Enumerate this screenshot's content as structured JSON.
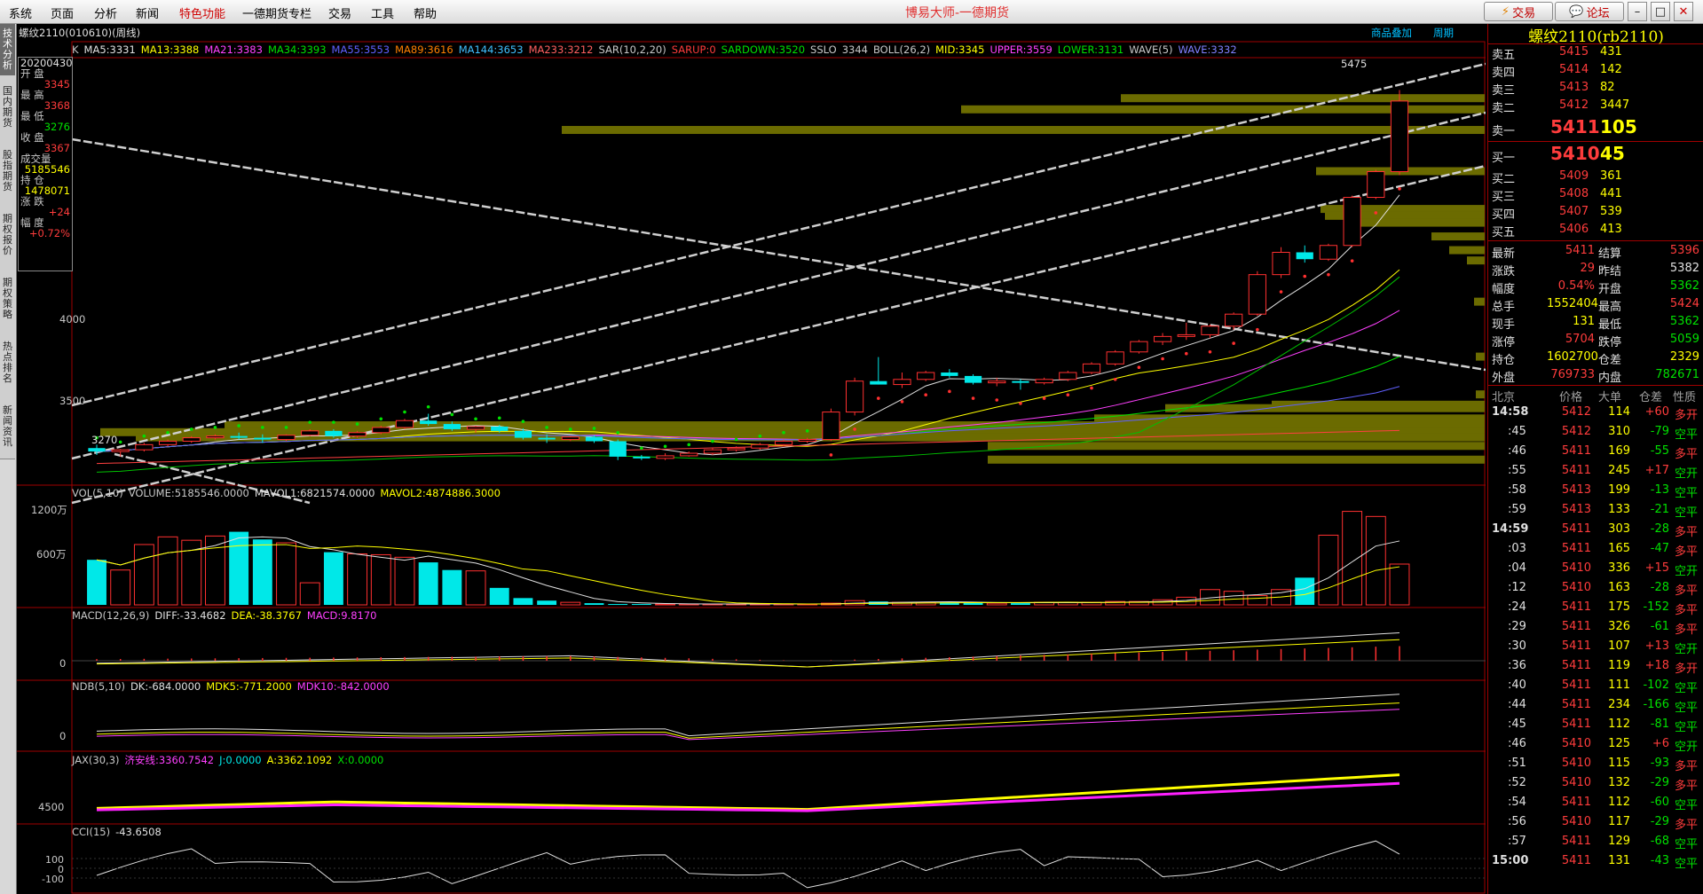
{
  "menu": {
    "items": [
      "系统",
      "页面",
      "分析",
      "新闻",
      "特色功能",
      "一德期货专栏",
      "交易",
      "工具",
      "帮助"
    ],
    "app_title": "博易大师-一德期货",
    "trade_button": "交易",
    "forum_button": "论坛"
  },
  "sidebar": {
    "tabs": [
      "技术分析",
      "国内期货",
      "股指期货",
      "期权报价",
      "期权策略",
      "热点排名",
      "新闻资讯"
    ]
  },
  "chart": {
    "title": "螺纹2110(010610)(周线)",
    "top_links": [
      "商品叠加",
      "周期"
    ],
    "peak_label": "5475",
    "low_label": "3270",
    "indicator_line": [
      {
        "text": "K",
        "color": "#c8c8c8"
      },
      {
        "text": "MA5:3331",
        "color": "#e0e0e0"
      },
      {
        "text": "MA13:3388",
        "color": "#ffff00"
      },
      {
        "text": "MA21:3383",
        "color": "#ff40ff"
      },
      {
        "text": "MA34:3393",
        "color": "#00e000"
      },
      {
        "text": "MA55:3553",
        "color": "#6060ff"
      },
      {
        "text": "MA89:3616",
        "color": "#ff8000"
      },
      {
        "text": "MA144:3653",
        "color": "#40c0ff"
      },
      {
        "text": "MA233:3212",
        "color": "#ff6060"
      },
      {
        "text": "SAR(10,2,20)",
        "color": "#c8c8c8"
      },
      {
        "text": "SARUP:0",
        "color": "#ff3c3c"
      },
      {
        "text": "SARDOWN:3520",
        "color": "#00e000"
      },
      {
        "text": "SSLO",
        "color": "#c8c8c8"
      },
      {
        "text": "3344",
        "color": "#c8c8c8"
      },
      {
        "text": "BOLL(26,2)",
        "color": "#c8c8c8"
      },
      {
        "text": "MID:3345",
        "color": "#ffff00"
      },
      {
        "text": "UPPER:3559",
        "color": "#ff40ff"
      },
      {
        "text": "LOWER:3131",
        "color": "#00e000"
      },
      {
        "text": "WAVE(5)",
        "color": "#c8c8c8"
      },
      {
        "text": "WAVE:3332",
        "color": "#8080ff"
      }
    ],
    "y_labels": [
      "4000",
      "3500"
    ],
    "info_box": {
      "date": "20200430",
      "rows": [
        {
          "label": "开  盘",
          "value": "3345",
          "color": "#ff3c3c"
        },
        {
          "label": "最  高",
          "value": "3368",
          "color": "#ff3c3c"
        },
        {
          "label": "最  低",
          "value": "3276",
          "color": "#00e000"
        },
        {
          "label": "收  盘",
          "value": "3367",
          "color": "#ff3c3c"
        },
        {
          "label": "成交量",
          "value": "5185546",
          "color": "#ffff00"
        },
        {
          "label": "持  仓",
          "value": "1478071",
          "color": "#ffff00"
        },
        {
          "label": "涨  跌",
          "value": "+24",
          "color": "#ff3c3c"
        },
        {
          "label": "幅  度",
          "value": "+0.72%",
          "color": "#ff3c3c"
        }
      ]
    }
  },
  "chart_data": {
    "type": "candlestick",
    "candles": [
      [
        3390,
        3410,
        3350,
        3370
      ],
      [
        3370,
        3385,
        3340,
        3380
      ],
      [
        3380,
        3420,
        3370,
        3410
      ],
      [
        3410,
        3440,
        3400,
        3430
      ],
      [
        3430,
        3460,
        3420,
        3450
      ],
      [
        3450,
        3470,
        3440,
        3460
      ],
      [
        3460,
        3480,
        3440,
        3450
      ],
      [
        3450,
        3470,
        3420,
        3440
      ],
      [
        3440,
        3470,
        3430,
        3465
      ],
      [
        3465,
        3500,
        3460,
        3490
      ],
      [
        3490,
        3500,
        3450,
        3460
      ],
      [
        3460,
        3490,
        3450,
        3480
      ],
      [
        3480,
        3520,
        3470,
        3510
      ],
      [
        3510,
        3560,
        3500,
        3550
      ],
      [
        3550,
        3590,
        3520,
        3530
      ],
      [
        3530,
        3545,
        3490,
        3500
      ],
      [
        3500,
        3520,
        3480,
        3515
      ],
      [
        3515,
        3525,
        3480,
        3490
      ],
      [
        3490,
        3505,
        3440,
        3450
      ],
      [
        3450,
        3470,
        3420,
        3440
      ],
      [
        3440,
        3460,
        3430,
        3455
      ],
      [
        3455,
        3465,
        3420,
        3430
      ],
      [
        3430,
        3440,
        3320,
        3340
      ],
      [
        3340,
        3350,
        3320,
        3330
      ],
      [
        3330,
        3360,
        3320,
        3345
      ],
      [
        3345,
        3370,
        3340,
        3360
      ],
      [
        3360,
        3390,
        3350,
        3380
      ],
      [
        3380,
        3400,
        3370,
        3390
      ],
      [
        3390,
        3420,
        3380,
        3410
      ],
      [
        3410,
        3440,
        3400,
        3430
      ],
      [
        3430,
        3450,
        3420,
        3440
      ],
      [
        3440,
        3620,
        3430,
        3600
      ],
      [
        3600,
        3800,
        3580,
        3780
      ],
      [
        3780,
        3920,
        3760,
        3760
      ],
      [
        3760,
        3830,
        3740,
        3790
      ],
      [
        3790,
        3840,
        3780,
        3830
      ],
      [
        3830,
        3850,
        3800,
        3810
      ],
      [
        3810,
        3820,
        3760,
        3770
      ],
      [
        3770,
        3800,
        3750,
        3780
      ],
      [
        3780,
        3790,
        3730,
        3770
      ],
      [
        3770,
        3800,
        3760,
        3790
      ],
      [
        3790,
        3840,
        3780,
        3830
      ],
      [
        3830,
        3890,
        3820,
        3880
      ],
      [
        3880,
        3960,
        3870,
        3950
      ],
      [
        3950,
        4020,
        3940,
        4010
      ],
      [
        4010,
        4060,
        3990,
        4040
      ],
      [
        4040,
        4120,
        4020,
        4050
      ],
      [
        4050,
        4110,
        4030,
        4100
      ],
      [
        4100,
        4180,
        4080,
        4170
      ],
      [
        4170,
        4420,
        4160,
        4400
      ],
      [
        4400,
        4560,
        4380,
        4530
      ],
      [
        4530,
        4570,
        4470,
        4490
      ],
      [
        4490,
        4580,
        4480,
        4570
      ],
      [
        4570,
        4860,
        4560,
        4850
      ],
      [
        4850,
        5010,
        4840,
        5000
      ],
      [
        5000,
        5475,
        4980,
        5411
      ]
    ],
    "volume": [
      5.3,
      4.1,
      7.1,
      8.0,
      7.6,
      8.1,
      8.6,
      7.7,
      7.3,
      2.6,
      6.2,
      6.0,
      5.9,
      5.6,
      5.0,
      4.1,
      4.0,
      2.0,
      0.8,
      0.5,
      0.3,
      0.2,
      0.1,
      0.1,
      0.1,
      0.1,
      0.1,
      0.1,
      0.1,
      0.1,
      0.1,
      0.2,
      0.5,
      0.4,
      0.3,
      0.3,
      0.3,
      0.3,
      0.2,
      0.2,
      0.3,
      0.3,
      0.3,
      0.4,
      0.4,
      0.6,
      0.9,
      1.8,
      1.6,
      1.1,
      1.8,
      3.2,
      8.2,
      11.0,
      10.4,
      4.8
    ],
    "volume_unit": "万",
    "vol_label_values": [
      "1200万",
      "600万"
    ],
    "price_range": [
      3200,
      5550
    ]
  },
  "indicators": {
    "vol": [
      {
        "text": "VOL(5,10)",
        "color": "#c8c8c8"
      },
      {
        "text": "VOLUME:5185546.0000",
        "color": "#c8c8c8"
      },
      {
        "text": "MAVOL1:6821574.0000",
        "color": "#e0e0e0"
      },
      {
        "text": "MAVOL2:4874886.3000",
        "color": "#ffff00"
      }
    ],
    "macd": [
      {
        "text": "MACD(12,26,9)",
        "color": "#c8c8c8"
      },
      {
        "text": "DIFF:-33.4682",
        "color": "#e0e0e0"
      },
      {
        "text": "DEA:-38.3767",
        "color": "#ffff00"
      },
      {
        "text": "MACD:9.8170",
        "color": "#ff40ff"
      }
    ],
    "ndb": [
      {
        "text": "NDB(5,10)",
        "color": "#c8c8c8"
      },
      {
        "text": "DK:-684.0000",
        "color": "#e0e0e0"
      },
      {
        "text": "MDK5:-771.2000",
        "color": "#ffff00"
      },
      {
        "text": "MDK10:-842.0000",
        "color": "#ff40ff"
      }
    ],
    "jax": [
      {
        "text": "JAX(30,3)",
        "color": "#c8c8c8"
      },
      {
        "text": "济安线:3360.7542",
        "color": "#ff40ff"
      },
      {
        "text": "J:0.0000",
        "color": "#00e8e8"
      },
      {
        "text": "A:3362.1092",
        "color": "#ffff00"
      },
      {
        "text": "X:0.0000",
        "color": "#00e000"
      }
    ],
    "cci": [
      {
        "text": "CCI(15)",
        "color": "#c8c8c8"
      },
      {
        "text": "-43.6508",
        "color": "#e0e0e0"
      }
    ],
    "macd_zero": "0",
    "ndb_zero": "0",
    "jax_label": "4500",
    "cci_labels": [
      "100",
      "0",
      "-100"
    ]
  },
  "quote": {
    "name": "螺纹2110(rb2110)",
    "asks": [
      {
        "label": "卖五",
        "price": "5415",
        "vol": "431"
      },
      {
        "label": "卖四",
        "price": "5414",
        "vol": "142"
      },
      {
        "label": "卖三",
        "price": "5413",
        "vol": "82"
      },
      {
        "label": "卖二",
        "price": "5412",
        "vol": "3447"
      }
    ],
    "ask1": {
      "label": "卖一",
      "price": "5411",
      "vol": "105"
    },
    "bid1": {
      "label": "买一",
      "price": "5410",
      "vol": "45"
    },
    "bids": [
      {
        "label": "买二",
        "price": "5409",
        "vol": "361"
      },
      {
        "label": "买三",
        "price": "5408",
        "vol": "441"
      },
      {
        "label": "买四",
        "price": "5407",
        "vol": "539"
      },
      {
        "label": "买五",
        "price": "5406",
        "vol": "413"
      }
    ],
    "stats": [
      {
        "l1": "最新",
        "v1": "5411",
        "c1": "#ff3c3c",
        "l2": "结算",
        "v2": "5396",
        "c2": "#ff3c3c"
      },
      {
        "l1": "涨跌",
        "v1": "29",
        "c1": "#ff3c3c",
        "l2": "昨结",
        "v2": "5382",
        "c2": "#e0e0e0"
      },
      {
        "l1": "幅度",
        "v1": "0.54%",
        "c1": "#ff3c3c",
        "l2": "开盘",
        "v2": "5362",
        "c2": "#00e000"
      },
      {
        "l1": "总手",
        "v1": "1552404",
        "c1": "#ffff00",
        "l2": "最高",
        "v2": "5424",
        "c2": "#ff3c3c"
      },
      {
        "l1": "现手",
        "v1": "131",
        "c1": "#ffff00",
        "l2": "最低",
        "v2": "5362",
        "c2": "#00e000"
      },
      {
        "l1": "涨停",
        "v1": "5704",
        "c1": "#ff3c3c",
        "l2": "跌停",
        "v2": "5059",
        "c2": "#00e000"
      },
      {
        "l1": "持仓",
        "v1": "1602700",
        "c1": "#ffff00",
        "l2": "仓差",
        "v2": "2329",
        "c2": "#ffff00"
      },
      {
        "l1": "外盘",
        "v1": "769733",
        "c1": "#ff3c3c",
        "l2": "内盘",
        "v2": "782671",
        "c2": "#00e000"
      }
    ],
    "tick_header": [
      "北京",
      "价格",
      "大单",
      "仓差",
      "性质"
    ],
    "ticks": [
      {
        "t": "14:58",
        "p": "5412",
        "v": "114",
        "d": "+60",
        "n": "多开",
        "bold": true
      },
      {
        "t": ":45",
        "p": "5412",
        "v": "310",
        "d": "-79",
        "n": "空平"
      },
      {
        "t": ":46",
        "p": "5411",
        "v": "169",
        "d": "-55",
        "n": "多平"
      },
      {
        "t": ":55",
        "p": "5411",
        "v": "245",
        "d": "+17",
        "n": "空开"
      },
      {
        "t": ":58",
        "p": "5413",
        "v": "199",
        "d": "-13",
        "n": "空平"
      },
      {
        "t": ":59",
        "p": "5413",
        "v": "133",
        "d": "-21",
        "n": "空平"
      },
      {
        "t": "14:59",
        "p": "5411",
        "v": "303",
        "d": "-28",
        "n": "多平",
        "bold": true
      },
      {
        "t": ":03",
        "p": "5411",
        "v": "165",
        "d": "-47",
        "n": "多平"
      },
      {
        "t": ":04",
        "p": "5410",
        "v": "336",
        "d": "+15",
        "n": "空开"
      },
      {
        "t": ":12",
        "p": "5410",
        "v": "163",
        "d": "-28",
        "n": "多平"
      },
      {
        "t": ":24",
        "p": "5411",
        "v": "175",
        "d": "-152",
        "n": "多平"
      },
      {
        "t": ":29",
        "p": "5411",
        "v": "326",
        "d": "-61",
        "n": "多平"
      },
      {
        "t": ":30",
        "p": "5411",
        "v": "107",
        "d": "+13",
        "n": "空开"
      },
      {
        "t": ":36",
        "p": "5411",
        "v": "119",
        "d": "+18",
        "n": "多开"
      },
      {
        "t": ":40",
        "p": "5411",
        "v": "111",
        "d": "-102",
        "n": "空平"
      },
      {
        "t": ":44",
        "p": "5411",
        "v": "234",
        "d": "-166",
        "n": "空平"
      },
      {
        "t": ":45",
        "p": "5411",
        "v": "112",
        "d": "-81",
        "n": "空平"
      },
      {
        "t": ":46",
        "p": "5410",
        "v": "125",
        "d": "+6",
        "n": "空开"
      },
      {
        "t": ":51",
        "p": "5410",
        "v": "115",
        "d": "-93",
        "n": "多平"
      },
      {
        "t": ":52",
        "p": "5410",
        "v": "132",
        "d": "-29",
        "n": "多平"
      },
      {
        "t": ":54",
        "p": "5411",
        "v": "112",
        "d": "-60",
        "n": "空平"
      },
      {
        "t": ":56",
        "p": "5410",
        "v": "117",
        "d": "-29",
        "n": "多平"
      },
      {
        "t": ":57",
        "p": "5411",
        "v": "129",
        "d": "-68",
        "n": "空平"
      },
      {
        "t": "15:00",
        "p": "5411",
        "v": "131",
        "d": "-43",
        "n": "空平",
        "bold": true
      }
    ]
  }
}
